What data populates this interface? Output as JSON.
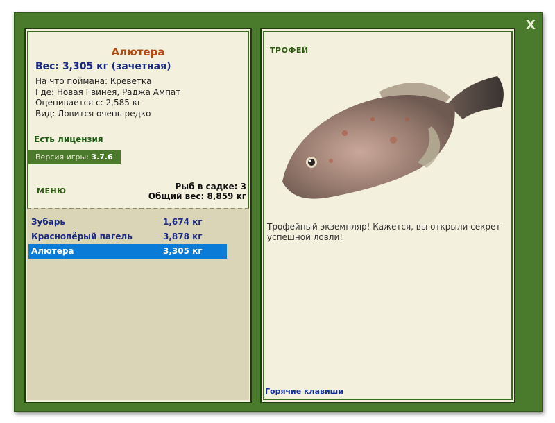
{
  "window": {
    "close_label": "X"
  },
  "left": {
    "fish_name": "Алютера",
    "weight_line": "Вес: 3,305 кг (зачетная)",
    "info": [
      "На что поймана: Креветка",
      "Где: Новая Гвинея, Раджа Ампат",
      "Оценивается с: 2,585 кг",
      "Вид: Ловится очень редко"
    ],
    "license": "Есть лицензия",
    "version_label": "Версия игры:",
    "version_value": "3.7.6",
    "menu": "МЕНЮ",
    "cage_count": "Рыб в садке: 3",
    "total_weight": "Общий вес: 8,859 кг",
    "fish_list": [
      {
        "name": "Зубарь",
        "weight": "1,674 кг",
        "selected": false
      },
      {
        "name": "Краснопёрый пагель",
        "weight": "3,878 кг",
        "selected": false
      },
      {
        "name": "Алютера",
        "weight": "3,305 кг",
        "selected": true
      }
    ]
  },
  "right": {
    "trophy": "ТРОФЕЙ",
    "description": "Трофейный экземпляр! Кажется, вы открыли секрет успешной ловли!",
    "hotkeys": "Горячие клавиши"
  },
  "colors": {
    "frame": "#4a7a2c",
    "panel_bg": "#f3f0dd",
    "list_bg": "#d9d5b6",
    "selected": "#0a7bd6",
    "title": "#b34a10"
  }
}
